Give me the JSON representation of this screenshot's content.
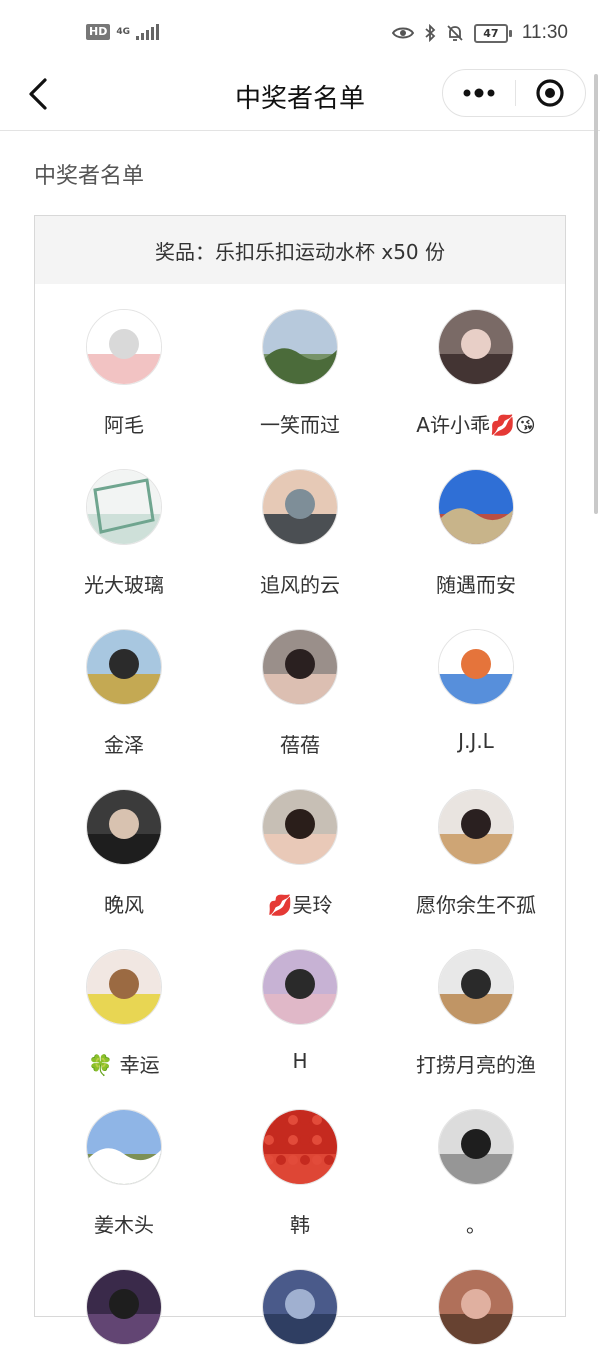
{
  "status_bar": {
    "hd": "HD",
    "network": "4G",
    "battery": "47",
    "time": "11:30"
  },
  "nav": {
    "title": "中奖者名单",
    "back_icon": "chevron-left-icon",
    "more_icon": "more-dots-icon",
    "close_icon": "target-close-icon"
  },
  "page": {
    "section_heading": "中奖者名单",
    "prize_text": "奖品：乐扣乐扣运动水杯 x50 份"
  },
  "winners": [
    {
      "name": "阿毛",
      "avatar_theme": "sketch-girl",
      "colors": [
        "#ffffff",
        "#d9d9d9",
        "#f0b8b8"
      ]
    },
    {
      "name": "一笑而过",
      "avatar_theme": "trees-landscape",
      "colors": [
        "#b7c9dc",
        "#4b6b3a",
        "#6c8a55"
      ]
    },
    {
      "name": "A许小乖💋😘",
      "avatar_theme": "couple-photo",
      "colors": [
        "#7a6a66",
        "#e8cfc7",
        "#3a2a2a"
      ]
    },
    {
      "name": "光大玻璃",
      "avatar_theme": "glass-panes",
      "colors": [
        "#f2f4f3",
        "#6fa58f",
        "#c8dcd4"
      ]
    },
    {
      "name": "追风的云",
      "avatar_theme": "ferris-wheel-dusk",
      "colors": [
        "#e6c9b6",
        "#7e8e98",
        "#2f3a42"
      ]
    },
    {
      "name": "随遇而安",
      "avatar_theme": "desert-sky",
      "colors": [
        "#2f6fd6",
        "#c8b48a",
        "#d24a2a"
      ]
    },
    {
      "name": "金泽",
      "avatar_theme": "man-field",
      "colors": [
        "#a8c7e0",
        "#2b2b2b",
        "#c9a33a"
      ]
    },
    {
      "name": "蓓蓓",
      "avatar_theme": "woman-portrait",
      "colors": [
        "#9a8f8a",
        "#2a2020",
        "#e7c8b8"
      ]
    },
    {
      "name": "J.J.L",
      "avatar_theme": "cartoon-boy",
      "colors": [
        "#ffffff",
        "#e5743b",
        "#3a7bd5"
      ]
    },
    {
      "name": "晚风",
      "avatar_theme": "man-mirror",
      "colors": [
        "#3b3b3b",
        "#d8c2b0",
        "#1a1a1a"
      ]
    },
    {
      "name": "💋吴玲",
      "avatar_theme": "woman-selfie",
      "colors": [
        "#c7bfb5",
        "#2a1e1a",
        "#eecab8"
      ]
    },
    {
      "name": "愿你余生不孤",
      "avatar_theme": "girl-dog",
      "colors": [
        "#e9e4e0",
        "#2a2020",
        "#c99a62"
      ]
    },
    {
      "name": "🍀 幸运",
      "avatar_theme": "brown-bear-plush",
      "colors": [
        "#f1e7e2",
        "#9b6a42",
        "#e6d23a"
      ]
    },
    {
      "name": "H",
      "avatar_theme": "couple-street",
      "colors": [
        "#c7b2d4",
        "#2a2a2a",
        "#e4b8c6"
      ]
    },
    {
      "name": "打捞月亮的渔",
      "avatar_theme": "man-dog-bw",
      "colors": [
        "#e8e8e8",
        "#2a2a2a",
        "#b8864e"
      ]
    },
    {
      "name": "姜木头",
      "avatar_theme": "sky-field",
      "colors": [
        "#8fb5e6",
        "#ffffff",
        "#7a8a3a"
      ]
    },
    {
      "name": "韩",
      "avatar_theme": "red-flowers",
      "colors": [
        "#c52a1f",
        "#3f6b2e",
        "#e24b3a"
      ]
    },
    {
      "name": "。",
      "avatar_theme": "woman-bw",
      "colors": [
        "#dcdcdc",
        "#1e1e1e",
        "#8a8a8a"
      ]
    },
    {
      "name": "",
      "avatar_theme": "partial-dark",
      "colors": [
        "#3a2a4a",
        "#1e1e1e",
        "#6a4a7a"
      ]
    },
    {
      "name": "",
      "avatar_theme": "partial-blue",
      "colors": [
        "#4a5a8a",
        "#a0b0d0",
        "#2a3a5a"
      ]
    },
    {
      "name": "",
      "avatar_theme": "partial-warm",
      "colors": [
        "#b0705a",
        "#e0b0a0",
        "#5a3a2a"
      ]
    }
  ]
}
